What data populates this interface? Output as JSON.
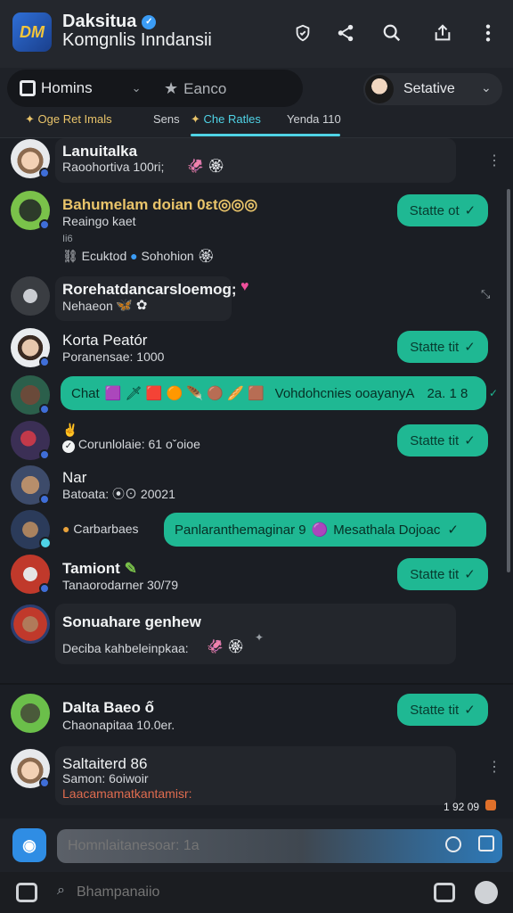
{
  "header": {
    "logo_text": "DM",
    "app_name": "Daksitua",
    "app_subtitle": "Komgnlis Inndansii",
    "icons": [
      "shield-icon",
      "share-icon",
      "search-icon",
      "upload-icon",
      "more-icon"
    ]
  },
  "toolbar": {
    "home_label": "Homins",
    "second_label": "Eanco",
    "profile_label": "Setative"
  },
  "tabs": [
    {
      "label": "Oge Ret Imals",
      "active": false
    },
    {
      "label": "Sens",
      "active": false
    },
    {
      "label": "Che Ratles",
      "active": true
    },
    {
      "label": "Yenda 110",
      "active": false
    }
  ],
  "rows": [
    {
      "name": "Lanuitalka",
      "sub": "Raoohortiva 100ri;"
    },
    {
      "name": "Bahumelam doian 0ɛt◎◎◎",
      "sub": "Reaingo kaet",
      "meta": "Ii6",
      "extra": "Ecuktod",
      "extra2": "Sohohion",
      "status": "Statte ot"
    },
    {
      "name": "Rorehatdancarsloemog;",
      "sub": "Nehaeon"
    },
    {
      "name": "Korta Peatór",
      "sub": "Poranensae: 1000",
      "status": "Statte tit"
    },
    {
      "bubble_prefix": "Chat",
      "bubble_text": "Vohdohcnies ooayanyA",
      "bubble_meta": "2a. 1 8"
    },
    {
      "sub": "Corunlolaie: 61 oˇoioe",
      "status": "Statte tit"
    },
    {
      "name": "Nar",
      "sub": "Batoata: ⦿⊙ 20021"
    },
    {
      "label": "Carbarbaes",
      "bubble_text": "Panlaranthemaginar 9",
      "bubble_text2": "Mesathala Dojoac"
    },
    {
      "name": "Tamiont",
      "sub": "Tanaorodarner 30/79",
      "status": "Statte tit"
    },
    {
      "name": "Sonuahare genhew",
      "sub": "Deciba kahbeleinpkaa:"
    },
    {
      "name": "Dalta Baeo ố",
      "sub": "Chaonapitaa 10.0er.",
      "status": "Statte tit"
    },
    {
      "name": "Saltaiterd 86",
      "sub": "Samon: 6oiwoir",
      "sub2": "Laacamamatkantamisr:",
      "time": "1 92 09"
    }
  ],
  "composer": {
    "placeholder": "Homnlaitanesoar: 1a"
  },
  "search": {
    "placeholder": "Bhampanaiio"
  },
  "colors": {
    "accent_teal": "#1fb893",
    "tab_active": "#4fd3e6",
    "background": "#1b1e24"
  }
}
